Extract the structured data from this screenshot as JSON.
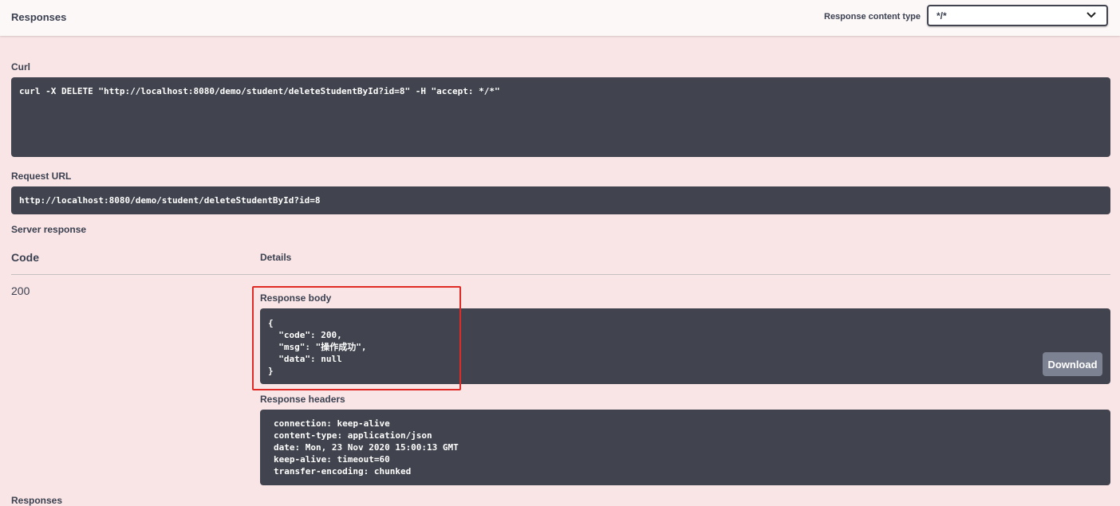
{
  "header": {
    "title": "Responses",
    "content_type_label": "Response content type",
    "content_type_value": "*/*"
  },
  "curl": {
    "label": "Curl",
    "command": "curl -X DELETE \"http://localhost:8080/demo/student/deleteStudentById?id=8\" -H \"accept: */*\""
  },
  "request_url": {
    "label": "Request URL",
    "value": "http://localhost:8080/demo/student/deleteStudentById?id=8"
  },
  "server_response": {
    "label": "Server response",
    "code_header": "Code",
    "details_header": "Details",
    "code": "200",
    "body_label": "Response body",
    "body": "{\n  \"code\": 200,\n  \"msg\": \"操作成功\",\n  \"data\": null\n}",
    "download_label": "Download",
    "headers_label": "Response headers",
    "headers": "connection: keep-alive\ncontent-type: application/json\ndate: Mon, 23 Nov 2020 15:00:13 GMT\nkeep-alive: timeout=60\ntransfer-encoding: chunked"
  },
  "footer": {
    "responses_label": "Responses"
  },
  "colors": {
    "background": "#f9e5e5",
    "code_block": "#41444e",
    "highlight": "#e02a25",
    "download_button": "#7d8293"
  }
}
